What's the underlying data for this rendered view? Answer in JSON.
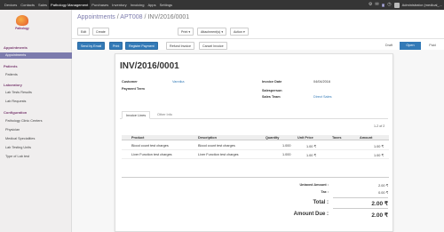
{
  "topbar": {
    "menu": [
      "Devices",
      "Contacts",
      "Sales",
      "Pathology Management",
      "Purchases",
      "Inventory",
      "Invoicing",
      "Apps",
      "Settings"
    ],
    "active_index": 3,
    "chat_badge": "2",
    "user": "Administrator (medical_..."
  },
  "sidebar": {
    "logo_text": "Pathology",
    "sections": [
      {
        "title": "Appointments",
        "items": [
          "Appointments"
        ]
      },
      {
        "title": "Patients",
        "items": [
          "Patients"
        ]
      },
      {
        "title": "Laboratory",
        "items": [
          "Lab Tests Results",
          "Lab Requests"
        ]
      },
      {
        "title": "Configuration",
        "items": [
          "Pathology Clinic Centers",
          "Physician",
          "Medical Specialities",
          "Lab Testing Units",
          "Type of Lab test"
        ]
      }
    ]
  },
  "breadcrumb": {
    "root": "Appointments",
    "middle": "APT008",
    "current": "INV/2016/0001",
    "sep": "/"
  },
  "control": {
    "edit": "Edit",
    "create": "Create",
    "print": "Print ▾",
    "attachments": "Attachment(s) ▾",
    "action": "Action ▾"
  },
  "actions": {
    "send_email": "Send by Email",
    "print": "Print",
    "register_payment": "Register Payment",
    "refund": "Refund Invoice",
    "cancel": "Cancel Invoice"
  },
  "statusbar": {
    "steps": [
      "Draft",
      "Open",
      "Paid"
    ],
    "active_index": 1
  },
  "invoice": {
    "number": "INV/2016/0001",
    "customer_label": "Customer",
    "customer": "Vannika",
    "payment_term_label": "Payment Term",
    "invoice_date_label": "Invoice Date",
    "invoice_date": "04/04/2016",
    "salesperson_label": "Salesperson",
    "sales_team_label": "Sales Team",
    "sales_team": "Direct Sales"
  },
  "tabs": [
    "Invoice Lines",
    "Other Info"
  ],
  "pager": "1-2 of 2",
  "lines": {
    "headers": [
      "Product",
      "Description",
      "Quantity",
      "Unit Price",
      "Taxes",
      "Amount"
    ],
    "rows": [
      [
        "Blood count test charges",
        "Blood count test charges",
        "1.000",
        "1.00 ₹",
        "",
        "1.00 ₹"
      ],
      [
        "Liver Function test charges",
        "Liver Function test charges",
        "1.000",
        "1.00 ₹",
        "",
        "1.00 ₹"
      ]
    ]
  },
  "totals": {
    "untaxed_label": "Untaxed Amount :",
    "untaxed": "2.00 ₹",
    "tax_label": "Tax :",
    "tax": "0.00 ₹",
    "total_label": "Total :",
    "total": "2.00 ₹",
    "due_label": "Amount Due :",
    "due": "2.00 ₹"
  },
  "colors": {
    "brand": "#7c7bad",
    "primary": "#337ab7",
    "topbar": "#353535",
    "section": "#7c3f73"
  }
}
